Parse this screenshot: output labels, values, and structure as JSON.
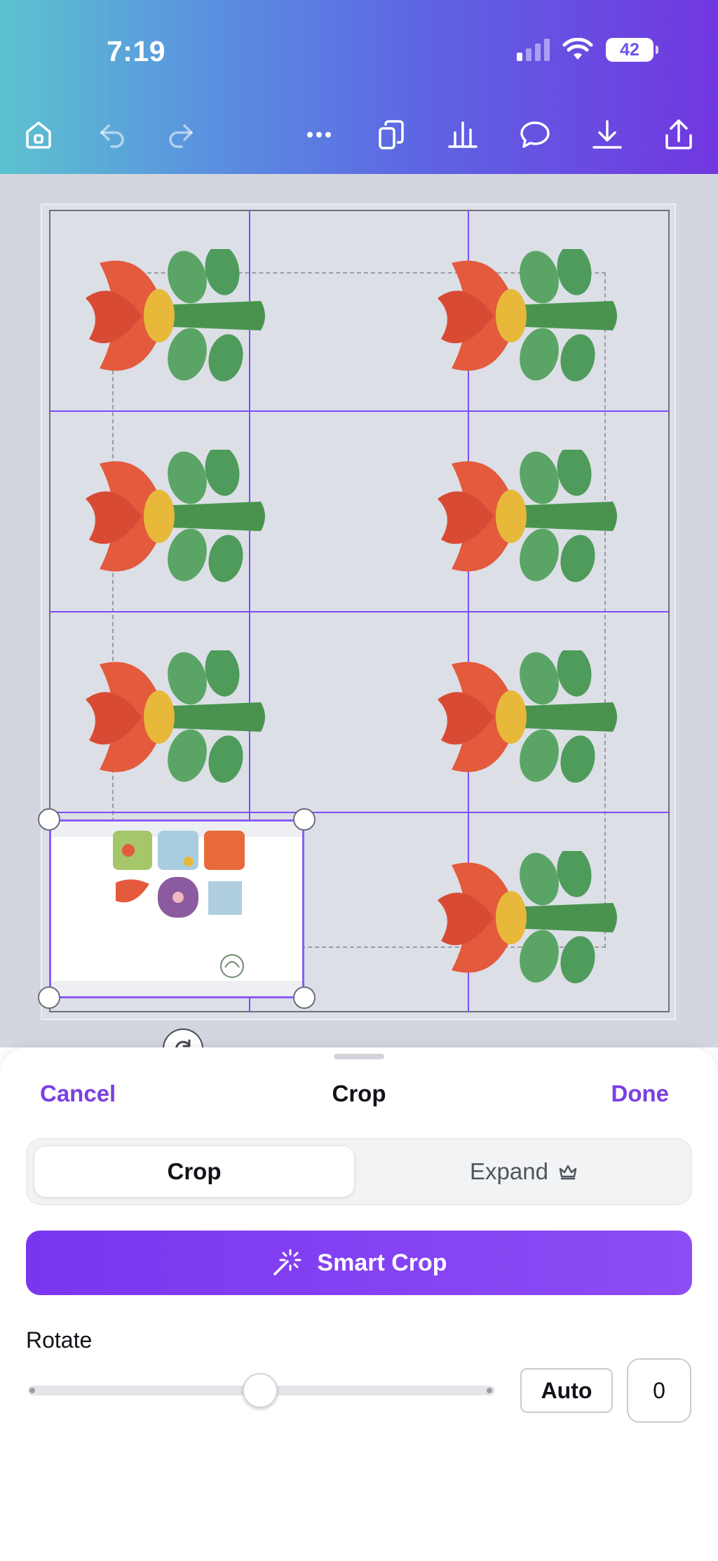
{
  "status_bar": {
    "time": "7:19",
    "battery": "42"
  },
  "toolbar": {
    "icons": [
      "home-icon",
      "undo-icon",
      "redo-icon",
      "more-icon",
      "copy-icon",
      "chart-icon",
      "comment-icon",
      "download-icon",
      "share-icon"
    ]
  },
  "canvas": {
    "grid_rows": 4,
    "grid_cols": 3,
    "flower_count": 8,
    "selected_element": "crop-image",
    "colors": {
      "guide": "#7c4dff",
      "petal": "#e25b3b",
      "center": "#e8b83a",
      "leaf": "#4e9a5c"
    }
  },
  "sheet": {
    "cancel_label": "Cancel",
    "title": "Crop",
    "done_label": "Done",
    "tabs": [
      {
        "label": "Crop",
        "active": true
      },
      {
        "label": "Expand",
        "active": false,
        "icon": "crown-icon"
      }
    ],
    "smart_crop_label": "Smart Crop",
    "rotate_label": "Rotate",
    "auto_label": "Auto",
    "angle_value": "0",
    "slider_fraction": 0.5
  },
  "colors": {
    "accent": "#7b3fe4",
    "button": "#8141f1"
  }
}
